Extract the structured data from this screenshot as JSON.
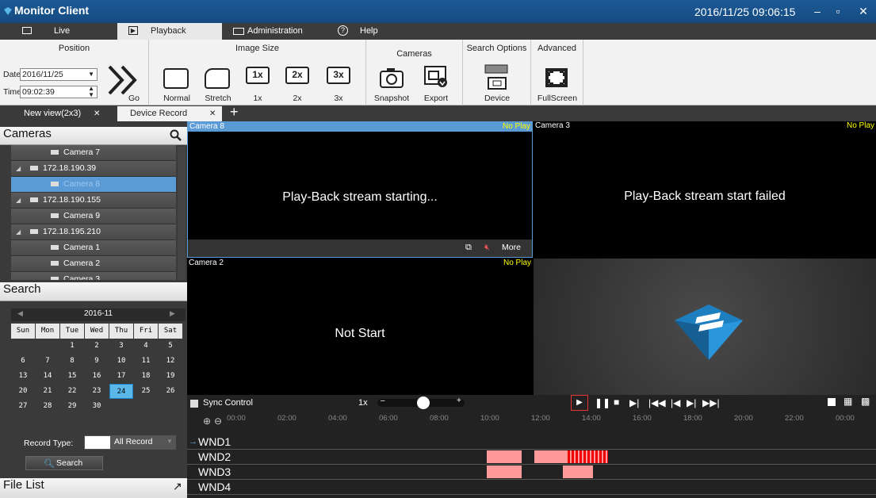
{
  "window": {
    "title": "Monitor Client",
    "clock": "2016/11/25 09:06:15"
  },
  "menu": {
    "tabs": [
      {
        "label": "Live"
      },
      {
        "label": "Playback"
      },
      {
        "label": "Administration"
      },
      {
        "label": "Help"
      }
    ]
  },
  "ribbon": {
    "position": {
      "title": "Position",
      "date_label": "Date",
      "date_value": "2016/11/25",
      "time_label": "Time",
      "time_value": "09:02:39",
      "go_label": "Go"
    },
    "image_size": {
      "title": "Image Size",
      "normal": "Normal",
      "stretch": "Stretch",
      "z1": "1x",
      "z2": "2x",
      "z3": "3x",
      "z1_icon": "1x",
      "z2_icon": "2x",
      "z3_icon": "3x"
    },
    "cameras": {
      "title": "Cameras",
      "snapshot": "Snapshot",
      "export": "Export"
    },
    "search_options": {
      "title": "Search Options",
      "device": "Device"
    },
    "advanced": {
      "title": "Advanced",
      "fullscreen": "FullScreen"
    }
  },
  "view_tabs": [
    {
      "label": "New view(2x3)"
    },
    {
      "label": "Device Record"
    }
  ],
  "cameras_panel": {
    "title": "Cameras",
    "items": [
      {
        "label": "Camera 7"
      },
      {
        "label": "172.18.190.39"
      },
      {
        "label": "Camera 8"
      },
      {
        "label": "172.18.190.155"
      },
      {
        "label": "Camera 9"
      },
      {
        "label": "172.18.195.210"
      },
      {
        "label": "Camera 1"
      },
      {
        "label": "Camera 2"
      },
      {
        "label": "Camera 3"
      }
    ]
  },
  "search_panel": {
    "title": "Search",
    "month": "2016-11",
    "weekdays": [
      "Sun",
      "Mon",
      "Tue",
      "Wed",
      "Thu",
      "Fri",
      "Sat"
    ],
    "weeks": [
      [
        "",
        "",
        "1",
        "2",
        "3",
        "4",
        "5"
      ],
      [
        "6",
        "7",
        "8",
        "9",
        "10",
        "11",
        "12"
      ],
      [
        "13",
        "14",
        "15",
        "16",
        "17",
        "18",
        "19"
      ],
      [
        "20",
        "21",
        "22",
        "23",
        "24",
        "25",
        "26"
      ],
      [
        "27",
        "28",
        "29",
        "30",
        "",
        "",
        ""
      ]
    ],
    "selected_day": "24",
    "record_type_label": "Record Type:",
    "record_type_value": "All Record",
    "search_button": "Search"
  },
  "file_list": {
    "title": "File List"
  },
  "video": {
    "panes": [
      {
        "camera": "Camera 8",
        "status": "No Play",
        "message": "Play-Back stream starting...",
        "more": "More"
      },
      {
        "camera": "Camera 3",
        "status": "No Play",
        "message": "Play-Back stream start failed"
      },
      {
        "camera": "Camera 2",
        "status": "No Play",
        "message": "Not Start"
      }
    ]
  },
  "timeline": {
    "sync_label": "Sync Control",
    "speed": "1x",
    "ticks": [
      "00:00",
      "02:00",
      "04:00",
      "06:00",
      "08:00",
      "10:00",
      "12:00",
      "14:00",
      "16:00",
      "18:00",
      "20:00",
      "22:00",
      "00:00"
    ],
    "windows": [
      "WND1",
      "WND2",
      "WND3",
      "WND4"
    ]
  },
  "colors": {
    "accent": "#1c5a96",
    "selection": "#5b9bd5",
    "record": "#ff9a9a",
    "alarm": "#dd0000",
    "no_play": "#ffff00"
  }
}
